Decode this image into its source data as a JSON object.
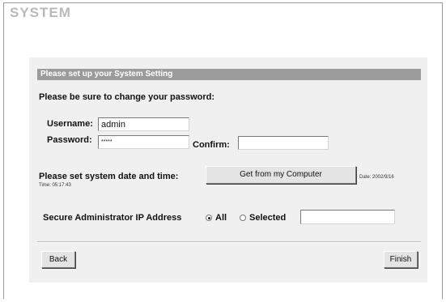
{
  "page": {
    "title": "SYSTEM"
  },
  "section": {
    "header": "Please set up your System Setting"
  },
  "password_section": {
    "heading": "Please be sure to change your password:",
    "username_label": "Username:",
    "username_value": "admin",
    "password_label": "Password:",
    "password_value": "*****",
    "confirm_label": "Confirm:",
    "confirm_value": ""
  },
  "datetime_section": {
    "heading": "Please set system date and time:",
    "button_label": "Get from my Computer",
    "date_text": "Date: 2002/9/16",
    "time_text": "Time: 05:17:43"
  },
  "ip_section": {
    "label": "Secure Administrator IP Address",
    "options": [
      {
        "label": "All",
        "selected": true
      },
      {
        "label": "Selected",
        "selected": false
      }
    ],
    "ip_value": ""
  },
  "footer": {
    "back_label": "Back",
    "finish_label": "Finish"
  }
}
